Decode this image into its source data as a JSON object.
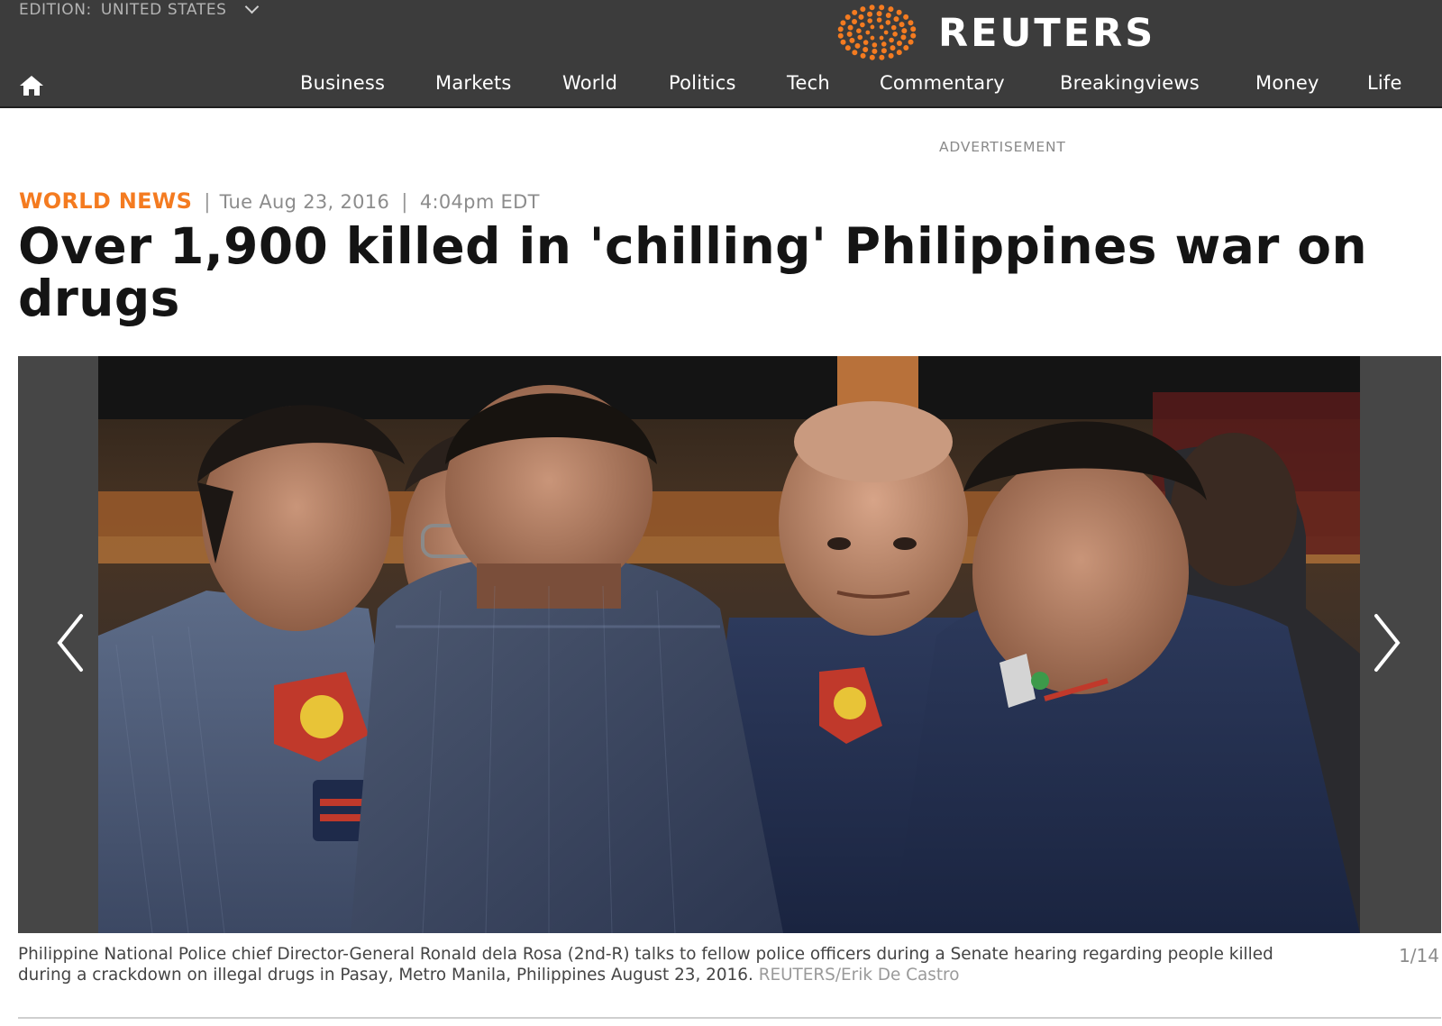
{
  "header": {
    "edition_label": "EDITION:",
    "edition_value": "UNITED STATES",
    "brand": "REUTERS",
    "logo_color": "#f47b20",
    "home_icon": "home-icon",
    "nav": [
      "Business",
      "Markets",
      "World",
      "Politics",
      "Tech",
      "Commentary",
      "Breakingviews",
      "Money",
      "Life"
    ]
  },
  "ad_label": "ADVERTISEMENT",
  "article": {
    "section": "WORLD NEWS",
    "separator": "|",
    "date": "Tue Aug 23, 2016",
    "time": "4:04pm EDT",
    "headline": "Over 1,900 killed in 'chilling' Philippines war on drugs",
    "accent_color": "#f47b20"
  },
  "slideshow": {
    "prev_icon": "chevron-left-icon",
    "next_icon": "chevron-right-icon",
    "caption": "Philippine National Police chief Director-General Ronald dela Rosa (2nd-R) talks to fellow police officers during a Senate hearing regarding people killed during a crackdown on illegal drugs in Pasay, Metro Manila, Philippines August 23, 2016.",
    "credit": "REUTERS/Erik De Castro",
    "counter": "1/14"
  }
}
